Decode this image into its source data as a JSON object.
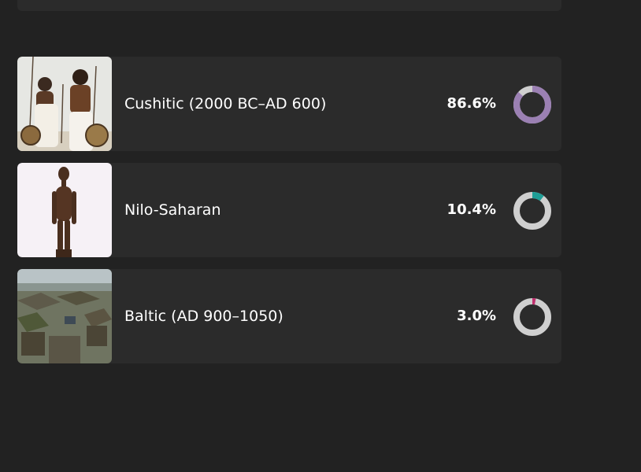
{
  "results": [
    {
      "label": "Cushitic (2000 BC–AD 600)",
      "percent_text": "86.6%",
      "percent": 86.6,
      "color": "#9b80b3",
      "thumbnail": "cushitic-warriors-illustration"
    },
    {
      "label": "Nilo-Saharan",
      "percent_text": "10.4%",
      "percent": 10.4,
      "color": "#1f9e96",
      "thumbnail": "carved-wooden-figure"
    },
    {
      "label": "Baltic (AD 900–1050)",
      "percent_text": "3.0%",
      "percent": 3.0,
      "color": "#c0306e",
      "thumbnail": "baltic-village-illustration"
    }
  ],
  "track_color": "#cfcfcf"
}
